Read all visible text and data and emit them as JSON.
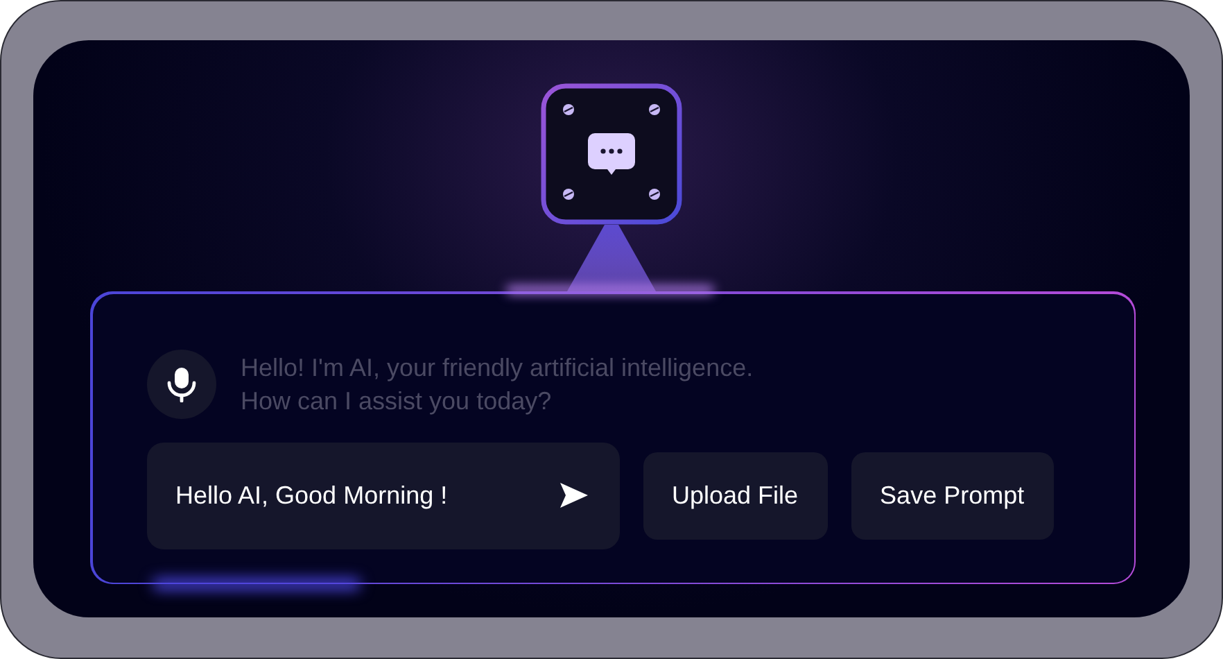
{
  "greeting": {
    "lines": [
      "Hello! I'm AI, your friendly artificial intelligence.",
      "How can I assist you today?"
    ]
  },
  "message_input": {
    "value": "Hello AI, Good Morning !"
  },
  "buttons": [
    "Upload File",
    "Save Prompt"
  ]
}
